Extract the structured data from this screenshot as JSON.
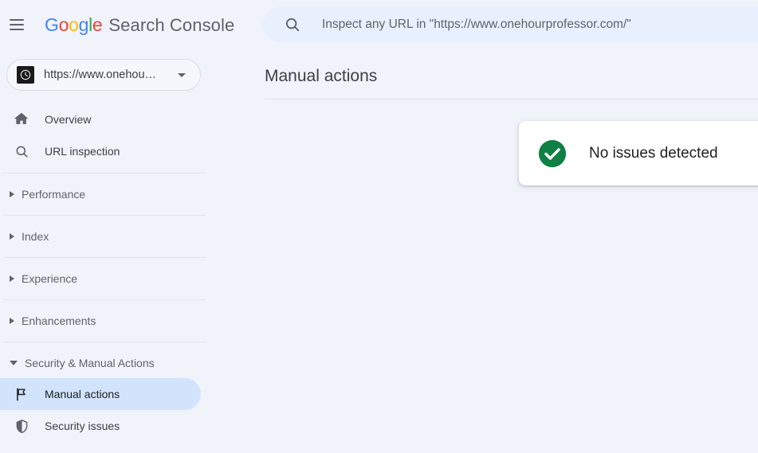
{
  "app": {
    "brand_google": "Google",
    "brand_product": "Search Console",
    "background_color": "#f0f3fa"
  },
  "topbar": {
    "menu_icon": "hamburger-menu-icon",
    "search": {
      "icon": "search-icon",
      "value": "",
      "placeholder": "Inspect any URL in \"https://www.onehourprofessor.com/\""
    }
  },
  "sidebar": {
    "property_selector": {
      "icon": "site-favicon-clock-icon",
      "label": "https://www.onehou…",
      "caret": "chevron-down-icon"
    },
    "items": [
      {
        "label": "Overview",
        "icon": "home-icon",
        "type": "link",
        "active": false
      },
      {
        "label": "URL inspection",
        "icon": "search-icon",
        "type": "link",
        "active": false
      },
      {
        "label": "Performance",
        "icon": "triangle-right-icon",
        "type": "group",
        "expanded": false
      },
      {
        "label": "Index",
        "icon": "triangle-right-icon",
        "type": "group",
        "expanded": false
      },
      {
        "label": "Experience",
        "icon": "triangle-right-icon",
        "type": "group",
        "expanded": false
      },
      {
        "label": "Enhancements",
        "icon": "triangle-right-icon",
        "type": "group",
        "expanded": false
      },
      {
        "label": "Security & Manual Actions",
        "icon": "triangle-down-icon",
        "type": "group",
        "expanded": true
      },
      {
        "label": "Manual actions",
        "icon": "flag-icon",
        "type": "sublink",
        "active": true
      },
      {
        "label": "Security issues",
        "icon": "shield-icon",
        "type": "sublink",
        "active": false
      }
    ],
    "active_item_color": "#d2e3fc"
  },
  "main": {
    "page_title": "Manual actions",
    "status_card": {
      "icon": "green-check-circle-icon",
      "icon_color": "#0f8043",
      "message": "No issues detected"
    }
  }
}
